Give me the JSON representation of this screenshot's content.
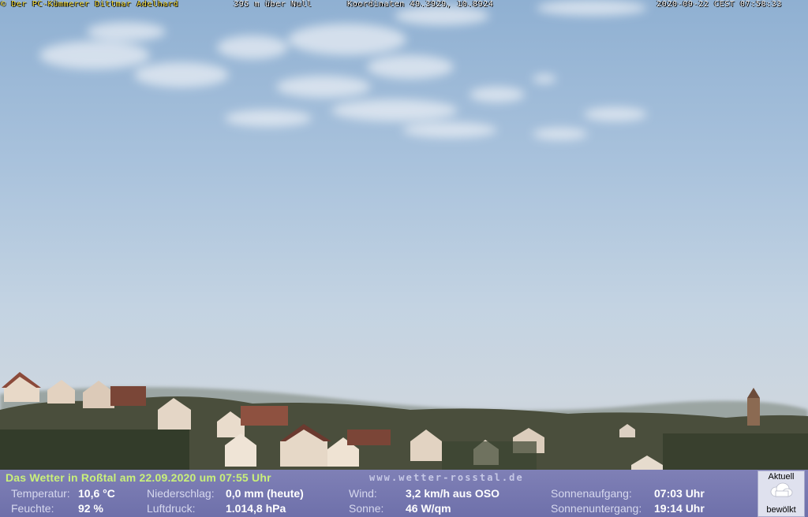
{
  "overlay": {
    "copyright": "© Der PC-Kümmerer Dittmar Adelhard",
    "altitude": "395 m über Null",
    "coordinates": "Koordinaten 49.3929, 10.8924",
    "timestamp": "2020-09-22 CEST 07:58:33"
  },
  "weather": {
    "headline": "Das Wetter in Roßtal am 22.09.2020 um 07:55 Uhr",
    "website": "www.wetter-rosstal.de",
    "temperature": {
      "label": "Temperatur:",
      "value": "10,6 °C"
    },
    "humidity": {
      "label": "Feuchte:",
      "value": "92 %"
    },
    "precipitation": {
      "label": "Niederschlag:",
      "value": "0,0 mm (heute)"
    },
    "pressure": {
      "label": "Luftdruck:",
      "value": "1.014,8 hPa"
    },
    "wind": {
      "label": "Wind:",
      "value": "3,2 km/h aus OSO"
    },
    "sun": {
      "label": "Sonne:",
      "value": "46 W/qm"
    },
    "sunrise": {
      "label": "Sonnenaufgang:",
      "value": "07:03 Uhr"
    },
    "sunset": {
      "label": "Sonnenuntergang:",
      "value": "19:14 Uhr"
    },
    "condition": {
      "heading": "Aktuell",
      "text": "bewölkt",
      "icon": "cloud-icon"
    }
  },
  "colors": {
    "headline": "#c9f07a",
    "panel": "#7576ae",
    "overlay_text": "#ffe640"
  }
}
